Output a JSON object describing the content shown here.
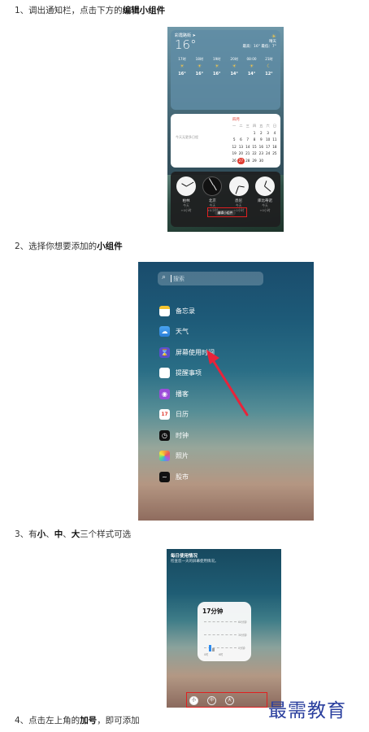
{
  "steps": [
    {
      "prefix": "1、调出通知栏，点击下方的",
      "bold": "编辑小组件",
      "suffix": ""
    },
    {
      "prefix": "2、选择你想要添加的",
      "bold": "小组件",
      "suffix": ""
    },
    {
      "prefix": "3、有",
      "bold1": "小",
      "mid1": "、",
      "bold2": "中",
      "mid2": "、",
      "bold3": "大",
      "suffix": "三个样式可选"
    },
    {
      "prefix": "4、点击左上角的",
      "bold": "加号",
      "suffix": "，即可添加"
    }
  ],
  "screenshot1": {
    "weather": {
      "location": "彩霞路街 ➤",
      "temp": "16°",
      "condition": "晴天",
      "high_low": "最高：16° 最低：7°",
      "hours": [
        {
          "time": "17时",
          "icon": "☀",
          "temp": "16°"
        },
        {
          "time": "18时",
          "icon": "☀",
          "temp": "16°"
        },
        {
          "time": "19时",
          "icon": "☀",
          "temp": "16°"
        },
        {
          "time": "20时",
          "icon": "☀",
          "temp": "14°"
        },
        {
          "time": "08:00",
          "icon": "☀",
          "temp": "14°"
        },
        {
          "time": "21时",
          "icon": "☾",
          "temp": "12°"
        }
      ]
    },
    "calendar": {
      "note": "今天无更多日程",
      "month": "四月",
      "headers": [
        "一",
        "二",
        "三",
        "四",
        "五",
        "六",
        "日"
      ],
      "days": [
        "",
        "",
        "",
        "1",
        "2",
        "3",
        "4",
        "5",
        "6",
        "7",
        "8",
        "9",
        "10",
        "11",
        "12",
        "13",
        "14",
        "15",
        "16",
        "17",
        "18",
        "19",
        "20",
        "21",
        "22",
        "23",
        "24",
        "25",
        "26",
        "27",
        "28",
        "29",
        "30",
        "",
        ""
      ],
      "today": "27"
    },
    "clocks": [
      {
        "city": "柏林",
        "day": "今天",
        "offset": "+0小时",
        "dark": false
      },
      {
        "city": "北京",
        "day": "今天",
        "offset": "+0小时",
        "dark": true
      },
      {
        "city": "悉尼",
        "day": "今天",
        "offset": "+0小时",
        "dark": false
      },
      {
        "city": "库比蒂诺",
        "day": "今天",
        "offset": "+0小时",
        "dark": false
      }
    ],
    "edit_button": "编辑小组件"
  },
  "screenshot2": {
    "search_placeholder": "搜索",
    "apps": [
      {
        "label": "备忘录",
        "icon": "notes-icon",
        "cls": "ic-notes",
        "glyph": ""
      },
      {
        "label": "天气",
        "icon": "weather-icon",
        "cls": "ic-weather",
        "glyph": "☁"
      },
      {
        "label": "屏幕使用时间",
        "icon": "hourglass-icon",
        "cls": "ic-screen",
        "glyph": "⌛"
      },
      {
        "label": "提醒事项",
        "icon": "reminders-icon",
        "cls": "ic-remind",
        "glyph": ""
      },
      {
        "label": "播客",
        "icon": "podcast-icon",
        "cls": "ic-podcast",
        "glyph": "◉"
      },
      {
        "label": "日历",
        "icon": "calendar-icon",
        "cls": "ic-cal",
        "glyph": "17"
      },
      {
        "label": "时钟",
        "icon": "clock-icon",
        "cls": "ic-clock",
        "glyph": "◷"
      },
      {
        "label": "照片",
        "icon": "photos-icon",
        "cls": "ic-photos",
        "glyph": ""
      },
      {
        "label": "股市",
        "icon": "stocks-icon",
        "cls": "ic-stocks",
        "glyph": "~"
      }
    ],
    "accent": "#e8233a"
  },
  "screenshot3": {
    "title": "每日使用情况",
    "desc": "检查您一天的屏幕使用情况。",
    "time": "17分钟",
    "labels": [
      "60分钟",
      "30分钟",
      "0分钟"
    ],
    "axis": [
      "0时",
      "6时"
    ],
    "sizes": [
      "小",
      "中",
      "大"
    ],
    "selected": "小"
  },
  "watermark": "最需教育"
}
